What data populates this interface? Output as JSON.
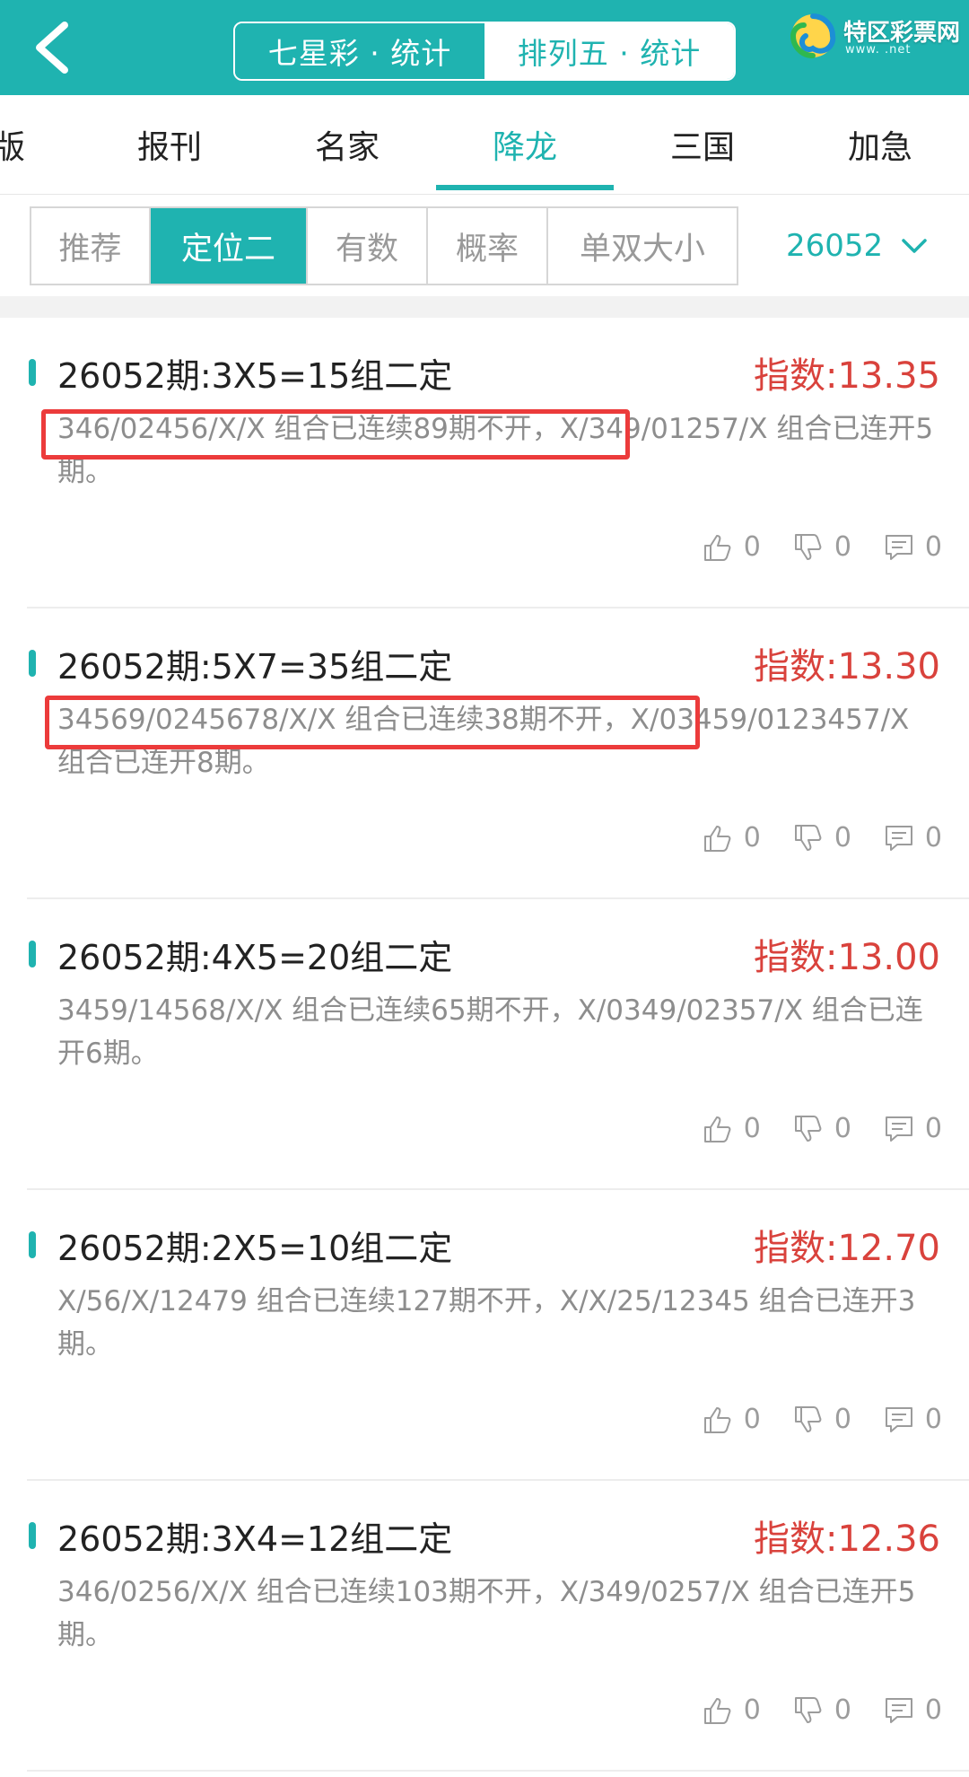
{
  "header": {
    "segments": [
      {
        "label": "七星彩 · 统计",
        "active": true
      },
      {
        "label": "排列五 · 统计",
        "active": false
      }
    ],
    "logo": {
      "name": "特区彩票网",
      "sub": "www.  .net"
    }
  },
  "tabs": [
    {
      "label": "版",
      "active": false
    },
    {
      "label": "报刊",
      "active": false
    },
    {
      "label": "名家",
      "active": false
    },
    {
      "label": "降龙",
      "active": true
    },
    {
      "label": "三国",
      "active": false
    },
    {
      "label": "加急",
      "active": false
    }
  ],
  "subtabs": [
    {
      "label": "推荐",
      "active": false
    },
    {
      "label": "定位二",
      "active": true
    },
    {
      "label": "有数",
      "active": false
    },
    {
      "label": "概率",
      "active": false
    },
    {
      "label": "单双大小",
      "active": false
    }
  ],
  "issue_selector": {
    "value": "26052"
  },
  "cards": [
    {
      "title": "26052期:3X5=15组二定",
      "index": "指数:13.35",
      "desc": "346/02456/X/X 组合已连续89期不开，X/349/01257/X 组合已连开5期。",
      "likes": "0",
      "dislikes": "0",
      "comments": "0"
    },
    {
      "title": "26052期:5X7=35组二定",
      "index": "指数:13.30",
      "desc": "34569/0245678/X/X 组合已连续38期不开，X/03459/0123457/X 组合已连开8期。",
      "likes": "0",
      "dislikes": "0",
      "comments": "0"
    },
    {
      "title": "26052期:4X5=20组二定",
      "index": "指数:13.00",
      "desc": "3459/14568/X/X 组合已连续65期不开，X/0349/02357/X 组合已连开6期。",
      "likes": "0",
      "dislikes": "0",
      "comments": "0"
    },
    {
      "title": "26052期:2X5=10组二定",
      "index": "指数:12.70",
      "desc": "X/56/X/12479 组合已连续127期不开，X/X/25/12345 组合已连开3期。",
      "likes": "0",
      "dislikes": "0",
      "comments": "0"
    },
    {
      "title": "26052期:3X4=12组二定",
      "index": "指数:12.36",
      "desc": "346/0256/X/X 组合已连续103期不开，X/349/0257/X 组合已连开5期。",
      "likes": "0",
      "dislikes": "0",
      "comments": "0"
    }
  ],
  "colors": {
    "accent": "#1fb3b0",
    "index_red": "#d9423c",
    "highlight": "#ec3b3b"
  }
}
